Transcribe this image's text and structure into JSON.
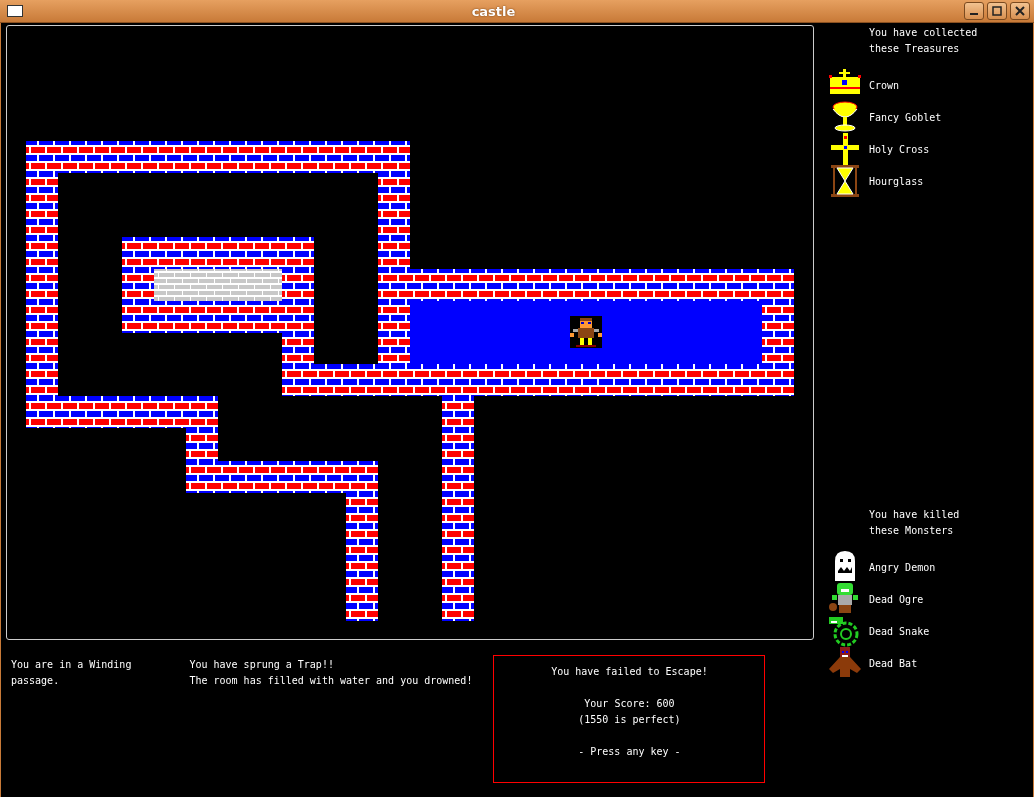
{
  "window": {
    "title": "castle"
  },
  "treasures": {
    "heading": "You have collected these Treasures",
    "items": [
      {
        "kind": "crown",
        "label": "Crown"
      },
      {
        "kind": "goblet",
        "label": "Fancy Goblet"
      },
      {
        "kind": "cross",
        "label": "Holy Cross"
      },
      {
        "kind": "hourglass",
        "label": "Hourglass"
      }
    ]
  },
  "monsters": {
    "heading": "You have killed these Monsters",
    "items": [
      {
        "kind": "ghost",
        "label": "Angry Demon"
      },
      {
        "kind": "ogre",
        "label": "Dead Ogre"
      },
      {
        "kind": "snake",
        "label": "Dead Snake"
      },
      {
        "kind": "bat",
        "label": "Dead Bat"
      }
    ]
  },
  "messages": {
    "location": "You are in a Winding passage.",
    "event_lines": [
      "You have sprung a Trap!!",
      "The room has filled with water and you drowned!"
    ]
  },
  "result": {
    "title": "You have failed to Escape!",
    "score": "Your Score: 600",
    "perfect": "(1550 is perfect)",
    "prompt": "- Press any key -"
  }
}
